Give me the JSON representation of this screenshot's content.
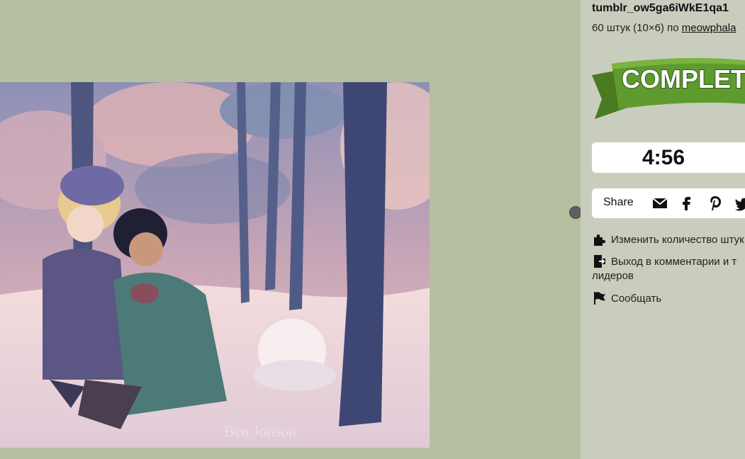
{
  "puzzle": {
    "title": "tumblr_ow5ga6iWkE1qa1",
    "meta_prefix": "60 штук (10×6) по ",
    "author": "meowphala",
    "image_signature": "Ben Jonson"
  },
  "banner": {
    "text": "COMPLETE"
  },
  "timer": {
    "value": "4:56"
  },
  "share": {
    "label": "Share",
    "icons": [
      "email-icon",
      "facebook-icon",
      "pinterest-icon",
      "twitter-icon"
    ]
  },
  "actions": [
    {
      "icon": "puzzle-piece-icon",
      "label": "Изменить количество штук"
    },
    {
      "icon": "exit-door-icon",
      "label": "Выход в комментарии и т",
      "label_line2": "лидеров"
    },
    {
      "icon": "flag-icon",
      "label": "Сообщать"
    }
  ],
  "colors": {
    "background": "#b7bfa1",
    "sidebar": "#c9cdbe",
    "banner_green": "#5a8a2a",
    "banner_text": "#ffffff"
  }
}
